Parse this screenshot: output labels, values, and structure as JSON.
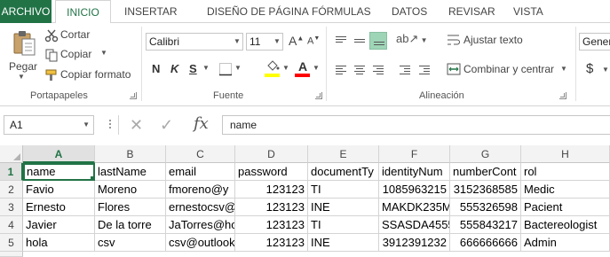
{
  "tabs": [
    "ARCHIVO",
    "INICIO",
    "INSERTAR",
    "DISEÑO DE PÁGINA",
    "FÓRMULAS",
    "DATOS",
    "REVISAR",
    "VISTA"
  ],
  "clipboard": {
    "paste_label": "Pegar",
    "cut_label": "Cortar",
    "copy_label": "Copiar",
    "copy_format_label": "Copiar formato",
    "group_label": "Portapapeles"
  },
  "font": {
    "family": "Calibri",
    "size": "11",
    "grow": "A",
    "shrink": "A",
    "bold": "N",
    "italic": "K",
    "underline": "S",
    "fill_letter": "",
    "color_letter": "A",
    "group_label": "Fuente",
    "colors": {
      "highlight": "#ffff00",
      "font": "#ff0000"
    }
  },
  "alignment": {
    "wrap_label": "Ajustar texto",
    "merge_label": "Combinar y centrar",
    "group_label": "Alineación"
  },
  "number": {
    "format_value": "Gener",
    "currency_symbol": "$"
  },
  "formula_bar": {
    "cell_ref": "A1",
    "content": "name",
    "fx": "fx"
  },
  "sheet": {
    "columns": [
      "A",
      "B",
      "C",
      "D",
      "E",
      "F",
      "G",
      "H"
    ],
    "row_numbers": [
      "1",
      "2",
      "3",
      "4",
      "5"
    ],
    "rows": [
      [
        "name",
        "lastName",
        "email",
        "password",
        "documentTy",
        "identityNum",
        "numberCont",
        "rol"
      ],
      [
        "Favio",
        "Moreno",
        "fmoreno@y",
        "123123",
        "TI",
        "1085963215",
        "3152368585",
        "Medic"
      ],
      [
        "Ernesto",
        "Flores",
        "ernestocsv@",
        "123123",
        "INE",
        "MAKDK235M",
        "555326598",
        "Pacient"
      ],
      [
        "Javier",
        "De la torre",
        "JaTorres@ho",
        "123123",
        "TI",
        "SSASDA4555",
        "555843217",
        "Bactereologist"
      ],
      [
        "hola",
        "csv",
        "csv@outlook",
        "123123",
        "INE",
        "3912391232",
        "666666666",
        "Admin"
      ]
    ]
  },
  "colors": {
    "accent": "#217346",
    "selected_align": "#9fd5b7"
  }
}
